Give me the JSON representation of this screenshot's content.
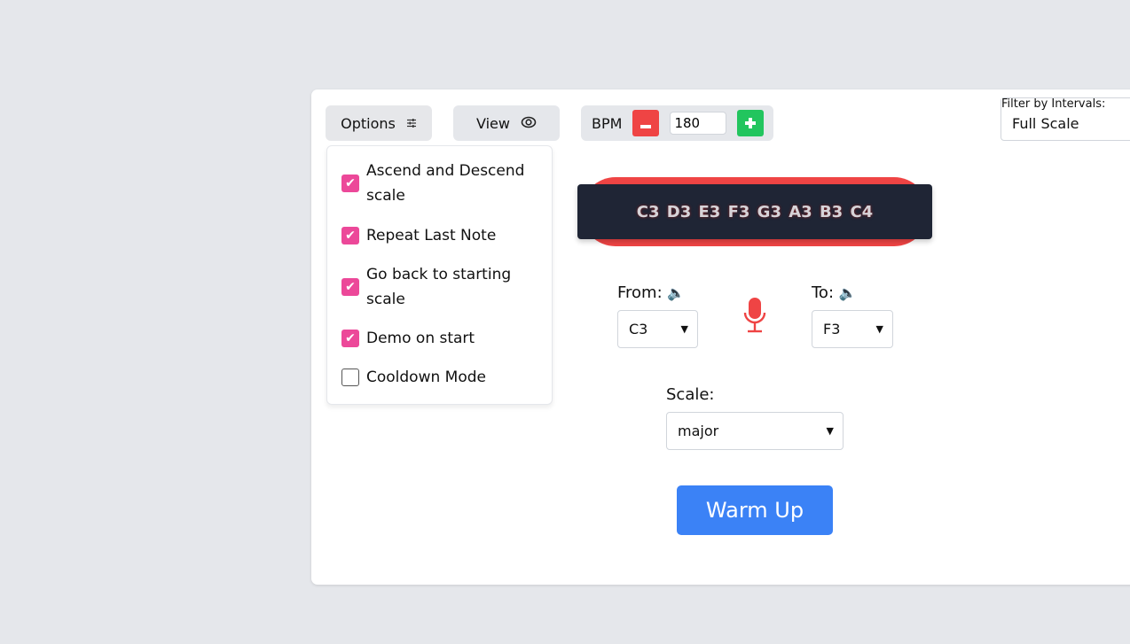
{
  "toolbar": {
    "options_label": "Options",
    "options_icon": "sliders-icon",
    "view_label": "View",
    "view_icon": "eye-icon",
    "bpm_label": "BPM",
    "bpm_value": "180",
    "decrement_icon": "minus-icon",
    "increment_icon": "plus-icon"
  },
  "filter": {
    "label": "Filter by Intervals:",
    "value": "Full Scale"
  },
  "options_menu": {
    "items": [
      {
        "label": "Ascend and Descend scale",
        "checked": true
      },
      {
        "label": "Repeat Last Note",
        "checked": true
      },
      {
        "label": "Go back to starting scale",
        "checked": true
      },
      {
        "label": "Demo on start",
        "checked": true
      },
      {
        "label": "Cooldown Mode",
        "checked": false
      }
    ]
  },
  "notes_display": "C3 D3 E3 F3 G3 A3 B3 C4",
  "range": {
    "from_label": "From:",
    "from_value": "C3",
    "to_label": "To:",
    "to_value": "F3",
    "speaker_icon": "🔈"
  },
  "scale": {
    "label": "Scale:",
    "value": "major"
  },
  "warm_up_label": "Warm Up",
  "colors": {
    "checkbox": "#ec4899",
    "minus": "#ef4444",
    "plus": "#22c55e",
    "primary": "#3b82f6",
    "notes_bg": "#1f2535",
    "notes_accent": "#ef4444"
  }
}
